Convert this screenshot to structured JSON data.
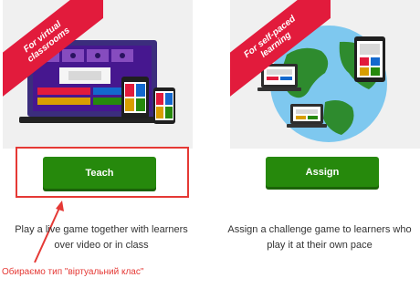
{
  "cards": [
    {
      "ribbon_text": "For virtual\nclassrooms",
      "button_label": "Teach",
      "description": "Play a live game together with learners\nover video or in class"
    },
    {
      "ribbon_text": "For self-paced\nlearning",
      "button_label": "Assign",
      "description": "Assign a challenge game to learners who\nplay it at their own pace"
    }
  ],
  "annotation": "Обираємо тип \"віртуальний клас\"",
  "colors": {
    "ribbon": "#e21b3c",
    "button": "#26890c",
    "highlight": "#e53935",
    "card_bg": "#f0f0f0"
  }
}
